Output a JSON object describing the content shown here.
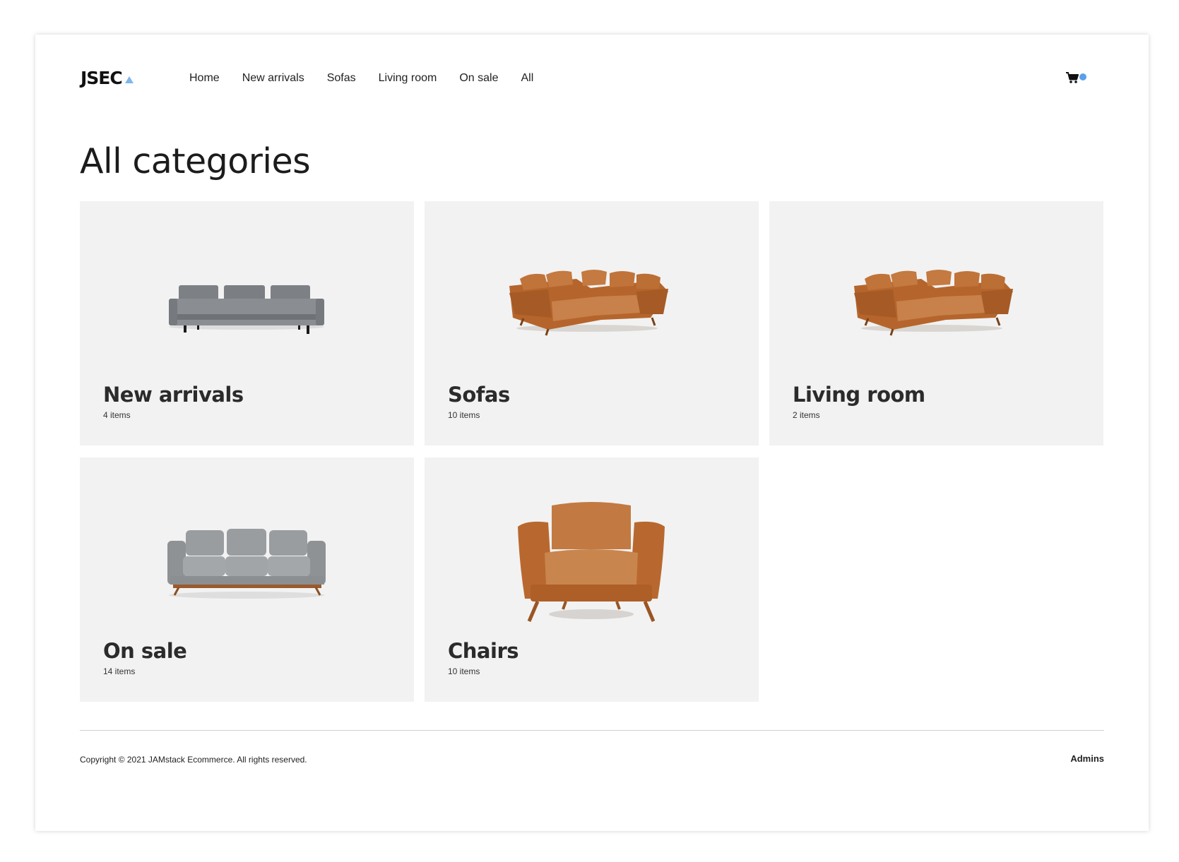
{
  "brand": {
    "logo_text": "JSEC",
    "accent_color": "#7fb6ec"
  },
  "nav": {
    "items": [
      "Home",
      "New arrivals",
      "Sofas",
      "Living room",
      "On sale",
      "All"
    ]
  },
  "cart": {
    "icon": "cart-icon",
    "badge_color": "#5aa0ea"
  },
  "page": {
    "title": "All categories"
  },
  "categories": [
    {
      "name": "New arrivals",
      "count": "4 items",
      "image": "grey-sofa"
    },
    {
      "name": "Sofas",
      "count": "10 items",
      "image": "leather-sectional"
    },
    {
      "name": "Living room",
      "count": "2 items",
      "image": "leather-sectional"
    },
    {
      "name": "On sale",
      "count": "14 items",
      "image": "grey-couch-wood-legs"
    },
    {
      "name": "Chairs",
      "count": "10 items",
      "image": "leather-armchair"
    }
  ],
  "footer": {
    "copyright": "Copyright © 2021 JAMstack Ecommerce. All rights reserved.",
    "admin_link": "Admins"
  }
}
